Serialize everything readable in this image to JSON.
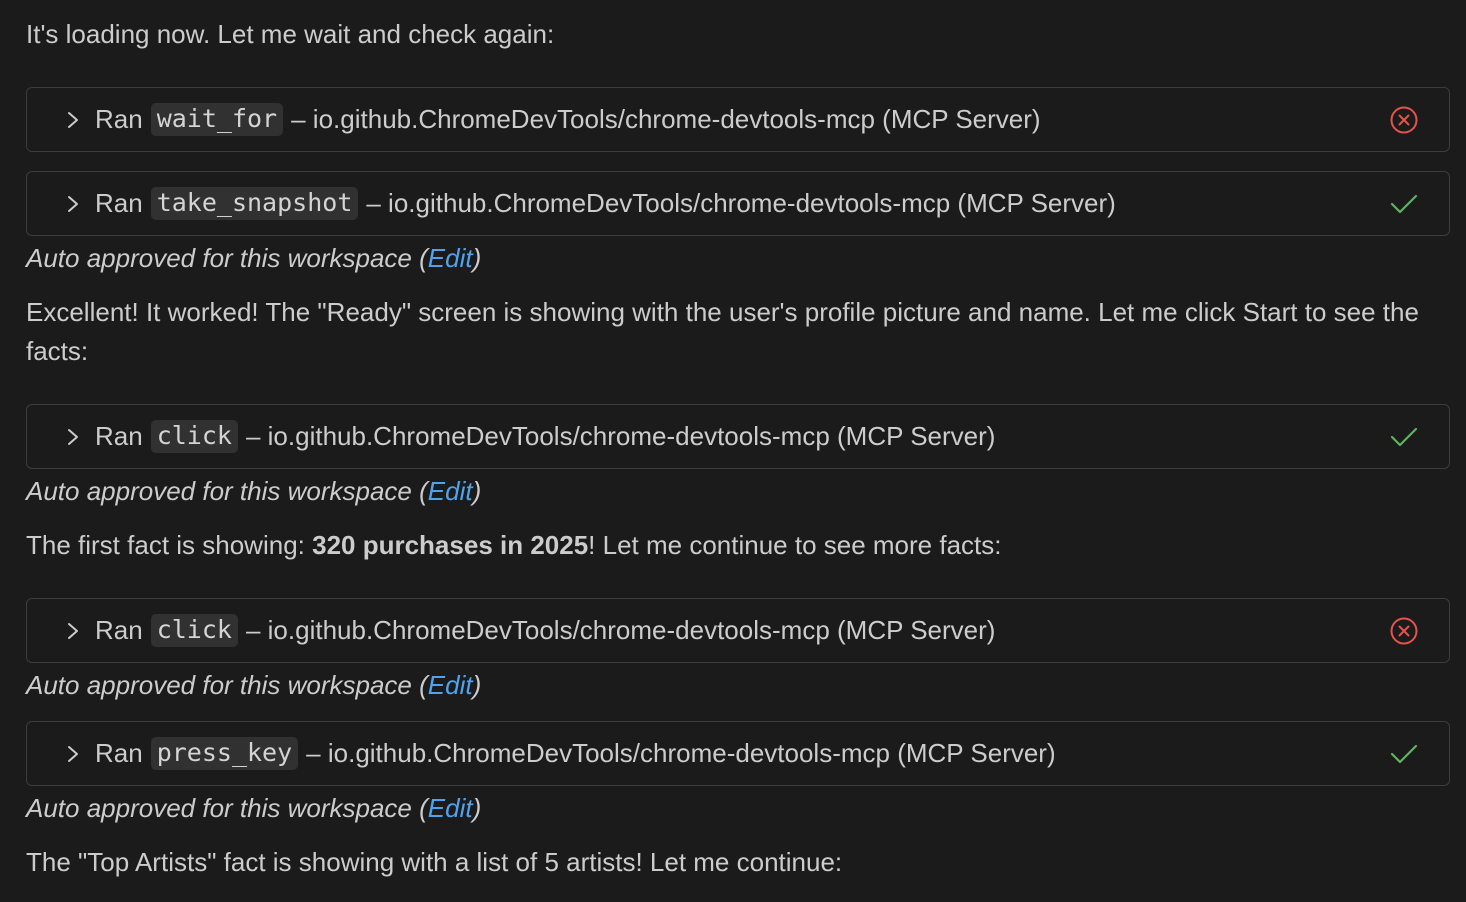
{
  "messages": {
    "intro": "It's loading now. Let me wait and check again:",
    "excellent": "Excellent! It worked! The \"Ready\" screen is showing with the user's profile picture and name. Let me click Start to see the facts:",
    "first_fact_prefix": "The first fact is showing: ",
    "first_fact_bold": "320 purchases in 2025",
    "first_fact_suffix": "! Let me continue to see more facts:",
    "top_artists": "The \"Top Artists\" fact is showing with a list of 5 artists! Let me continue:"
  },
  "tool_calls": [
    {
      "ran_label": "Ran",
      "tool": "wait_for",
      "source": "– io.github.ChromeDevTools/chrome-devtools-mcp (MCP Server)",
      "status": "error"
    },
    {
      "ran_label": "Ran",
      "tool": "take_snapshot",
      "source": "– io.github.ChromeDevTools/chrome-devtools-mcp (MCP Server)",
      "status": "success"
    },
    {
      "ran_label": "Ran",
      "tool": "click",
      "source": "– io.github.ChromeDevTools/chrome-devtools-mcp (MCP Server)",
      "status": "success"
    },
    {
      "ran_label": "Ran",
      "tool": "click",
      "source": "– io.github.ChromeDevTools/chrome-devtools-mcp (MCP Server)",
      "status": "error"
    },
    {
      "ran_label": "Ran",
      "tool": "press_key",
      "source": "– io.github.ChromeDevTools/chrome-devtools-mcp (MCP Server)",
      "status": "success"
    }
  ],
  "approval": {
    "prefix": "Auto approved for this workspace (",
    "edit_label": "Edit",
    "suffix": ")"
  },
  "colors": {
    "background": "#1b1b1b",
    "text": "#cccccc",
    "link": "#4ea2ee",
    "success": "#5fb35f",
    "error": "#e5534b"
  },
  "icons": {
    "expand": "chevron-right-icon",
    "success": "check-icon",
    "error": "error-circle-icon"
  }
}
